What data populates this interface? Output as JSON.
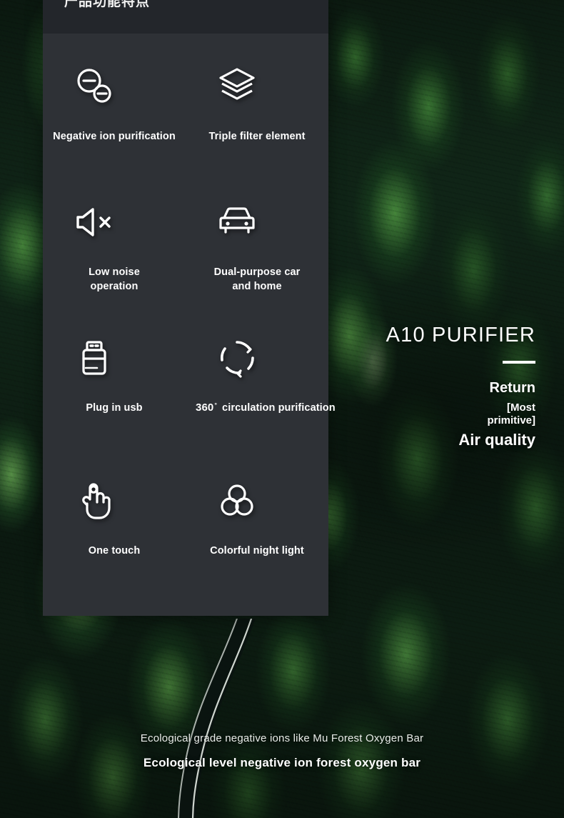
{
  "card": {
    "header_text": "产品功能特点",
    "features": [
      {
        "icon": "negative-ion-icon",
        "label": "Negative ion purification"
      },
      {
        "icon": "triple-layers-icon",
        "label": "Triple filter element"
      },
      {
        "icon": "mute-speaker-icon",
        "label": "Low noise\noperation"
      },
      {
        "icon": "car-icon",
        "label": "Dual-purpose car\nand home"
      },
      {
        "icon": "usb-icon",
        "label": "Plug in usb"
      },
      {
        "icon": "circulation-360-icon",
        "label": "circulation purification",
        "prefix_number": "360",
        "prefix_degree": "°"
      },
      {
        "icon": "touch-hand-icon",
        "label": "One touch"
      },
      {
        "icon": "three-circles-icon",
        "label": "Colorful night light"
      }
    ]
  },
  "hero": {
    "title": "A10 PURIFIER",
    "return_label": "Return",
    "bracket_label": "[Most\nprimitive]",
    "quality_label": "Air quality"
  },
  "captions": {
    "thin": "Ecological grade negative ions like Mu Forest Oxygen Bar",
    "bold": "Ecological level negative ion forest oxygen bar"
  },
  "colors": {
    "card_body": "#2e3136",
    "card_header": "#23262b",
    "text_white": "#ffffff",
    "forest_dark": "#0c1a11",
    "forest_highlight": "#7fbf5a"
  }
}
